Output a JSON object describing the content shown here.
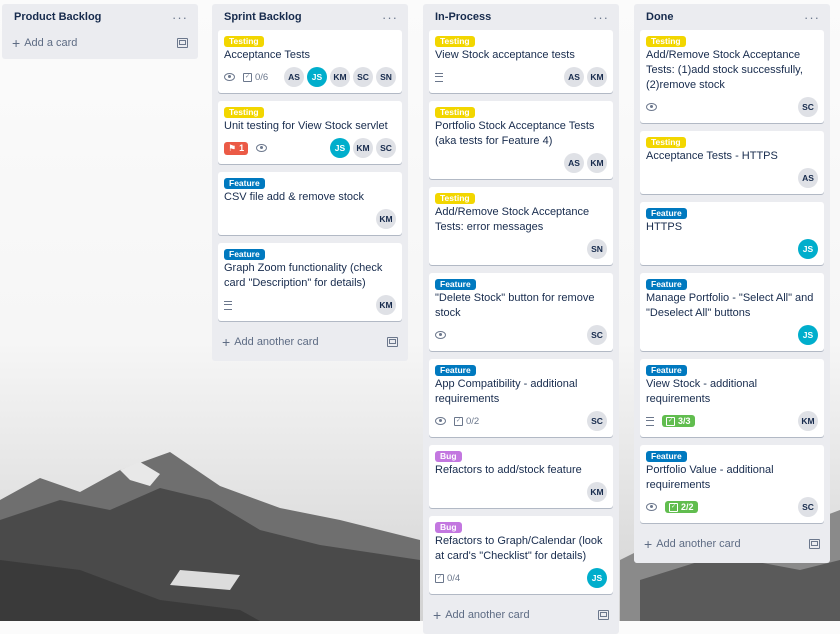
{
  "colors": {
    "testing": "#f2d600",
    "feature": "#0079bf",
    "bug": "#c377e0",
    "list_bg": "#ebecf0",
    "due_red": "#eb5a46",
    "done_green": "#61bd4f",
    "avatar_js": "#00aecc"
  },
  "lists": [
    {
      "title": "Product Backlog",
      "add_label": "Add a card",
      "cards": []
    },
    {
      "title": "Sprint Backlog",
      "add_label": "Add another card",
      "cards": [
        {
          "label": "Testing",
          "label_type": "testing",
          "title": "Acceptance Tests",
          "watch": true,
          "checklist": "0/6",
          "members": [
            "AS",
            "JS",
            "KM",
            "SC",
            "SN"
          ]
        },
        {
          "label": "Testing",
          "label_type": "testing",
          "title": "Unit testing for View Stock servlet",
          "due": "1",
          "watch": true,
          "members": [
            "JS",
            "KM",
            "SC"
          ]
        },
        {
          "label": "Feature",
          "label_type": "feature",
          "title": "CSV file add & remove stock",
          "members": [
            "KM"
          ]
        },
        {
          "label": "Feature",
          "label_type": "feature",
          "title": "Graph Zoom functionality (check card \"Description\" for details)",
          "description": true,
          "members": [
            "KM"
          ]
        }
      ]
    },
    {
      "title": "In-Process",
      "add_label": "Add another card",
      "cards": [
        {
          "label": "Testing",
          "label_type": "testing",
          "title": "View Stock acceptance tests",
          "description": true,
          "members": [
            "AS",
            "KM"
          ]
        },
        {
          "label": "Testing",
          "label_type": "testing",
          "title": "Portfolio Stock Acceptance Tests (aka tests for Feature 4)",
          "members": [
            "AS",
            "KM"
          ]
        },
        {
          "label": "Testing",
          "label_type": "testing",
          "title": "Add/Remove Stock Acceptance Tests: error messages",
          "members": [
            "SN"
          ]
        },
        {
          "label": "Feature",
          "label_type": "feature",
          "title": "\"Delete Stock\" button for remove stock",
          "watch": true,
          "members": [
            "SC"
          ]
        },
        {
          "label": "Feature",
          "label_type": "feature",
          "title": "App Compatibility - additional requirements",
          "watch": true,
          "checklist": "0/2",
          "members": [
            "SC"
          ]
        },
        {
          "label": "Bug",
          "label_type": "bug",
          "title": "Refactors to add/stock feature",
          "members": [
            "KM"
          ]
        },
        {
          "label": "Bug",
          "label_type": "bug",
          "title": "Refactors to Graph/Calendar (look at card's \"Checklist\" for details)",
          "checklist": "0/4",
          "members": [
            "JS"
          ]
        }
      ]
    },
    {
      "title": "Done",
      "add_label": "Add another card",
      "cards": [
        {
          "label": "Testing",
          "label_type": "testing",
          "title": "Add/Remove Stock Acceptance Tests: (1)add stock successfully, (2)remove stock",
          "watch": true,
          "members": [
            "SC"
          ]
        },
        {
          "label": "Testing",
          "label_type": "testing",
          "title": "Acceptance Tests - HTTPS",
          "members": [
            "AS"
          ]
        },
        {
          "label": "Feature",
          "label_type": "feature",
          "title": "HTTPS",
          "members": [
            "JS"
          ]
        },
        {
          "label": "Feature",
          "label_type": "feature",
          "title": "Manage Portfolio - \"Select All\" and \"Deselect All\" buttons",
          "members": [
            "JS"
          ]
        },
        {
          "label": "Feature",
          "label_type": "feature",
          "title": "View Stock - additional requirements",
          "description": true,
          "checklist_done": "3/3",
          "members": [
            "KM"
          ]
        },
        {
          "label": "Feature",
          "label_type": "feature",
          "title": "Portfolio Value - additional requirements",
          "watch": true,
          "checklist_done": "2/2",
          "members": [
            "SC"
          ]
        }
      ]
    }
  ]
}
